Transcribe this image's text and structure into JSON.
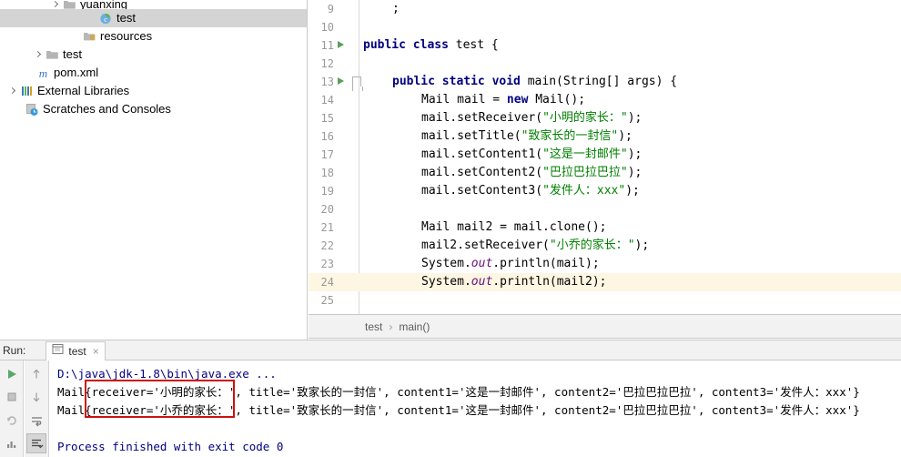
{
  "project_tree": {
    "items": [
      {
        "label": "yuanxing",
        "icon": "package-icon",
        "indent": 55,
        "arrow": true,
        "selected": false,
        "clipped": true
      },
      {
        "label": "test",
        "icon": "java-class-icon",
        "indent": 95,
        "arrow": false,
        "selected": true,
        "clipped": false
      },
      {
        "label": "resources",
        "icon": "resources-folder-icon",
        "indent": 77,
        "arrow": false,
        "selected": false,
        "clipped": false
      },
      {
        "label": "test",
        "icon": "folder-icon",
        "indent": 36,
        "arrow": true,
        "selected": false,
        "clipped": false
      },
      {
        "label": "pom.xml",
        "icon": "maven-icon",
        "indent": 26,
        "arrow": false,
        "selected": false,
        "clipped": false
      },
      {
        "label": "External Libraries",
        "icon": "libraries-icon",
        "indent": 8,
        "arrow": true,
        "selected": false,
        "clipped": false
      },
      {
        "label": "Scratches and Consoles",
        "icon": "scratches-icon",
        "indent": 14,
        "arrow": false,
        "selected": false,
        "clipped": false
      }
    ]
  },
  "editor": {
    "lines": [
      {
        "num": "9",
        "indent": 1,
        "run": false,
        "fold": false,
        "current": false,
        "tokens": [
          {
            "t": ";",
            "c": "pln"
          }
        ]
      },
      {
        "num": "10",
        "indent": 0,
        "run": false,
        "fold": false,
        "current": false,
        "tokens": []
      },
      {
        "num": "11",
        "indent": 0,
        "run": true,
        "fold": false,
        "current": false,
        "tokens": [
          {
            "t": "public class ",
            "c": "kw"
          },
          {
            "t": "test {",
            "c": "pln"
          }
        ]
      },
      {
        "num": "12",
        "indent": 0,
        "run": false,
        "fold": false,
        "current": false,
        "tokens": []
      },
      {
        "num": "13",
        "indent": 1,
        "run": true,
        "fold": true,
        "current": false,
        "tokens": [
          {
            "t": "public static void ",
            "c": "kw"
          },
          {
            "t": "main(String[] args) {",
            "c": "pln"
          }
        ]
      },
      {
        "num": "14",
        "indent": 2,
        "run": false,
        "fold": false,
        "current": false,
        "tokens": [
          {
            "t": "Mail mail = ",
            "c": "pln"
          },
          {
            "t": "new ",
            "c": "kw"
          },
          {
            "t": "Mail();",
            "c": "pln"
          }
        ]
      },
      {
        "num": "15",
        "indent": 2,
        "run": false,
        "fold": false,
        "current": false,
        "tokens": [
          {
            "t": "mail.setReceiver(",
            "c": "pln"
          },
          {
            "t": "\"小明的家长：\"",
            "c": "str"
          },
          {
            "t": ");",
            "c": "pln"
          }
        ]
      },
      {
        "num": "16",
        "indent": 2,
        "run": false,
        "fold": false,
        "current": false,
        "tokens": [
          {
            "t": "mail.setTitle(",
            "c": "pln"
          },
          {
            "t": "\"致家长的一封信\"",
            "c": "str"
          },
          {
            "t": ");",
            "c": "pln"
          }
        ]
      },
      {
        "num": "17",
        "indent": 2,
        "run": false,
        "fold": false,
        "current": false,
        "tokens": [
          {
            "t": "mail.setContent1(",
            "c": "pln"
          },
          {
            "t": "\"这是一封邮件\"",
            "c": "str"
          },
          {
            "t": ");",
            "c": "pln"
          }
        ]
      },
      {
        "num": "18",
        "indent": 2,
        "run": false,
        "fold": false,
        "current": false,
        "tokens": [
          {
            "t": "mail.setContent2(",
            "c": "pln"
          },
          {
            "t": "\"巴拉巴拉巴拉\"",
            "c": "str"
          },
          {
            "t": ");",
            "c": "pln"
          }
        ]
      },
      {
        "num": "19",
        "indent": 2,
        "run": false,
        "fold": false,
        "current": false,
        "tokens": [
          {
            "t": "mail.setContent3(",
            "c": "pln"
          },
          {
            "t": "\"发件人：xxx\"",
            "c": "str"
          },
          {
            "t": ");",
            "c": "pln"
          }
        ]
      },
      {
        "num": "20",
        "indent": 0,
        "run": false,
        "fold": false,
        "current": false,
        "tokens": []
      },
      {
        "num": "21",
        "indent": 2,
        "run": false,
        "fold": false,
        "current": false,
        "tokens": [
          {
            "t": "Mail mail2 = mail.clone();",
            "c": "pln"
          }
        ]
      },
      {
        "num": "22",
        "indent": 2,
        "run": false,
        "fold": false,
        "current": false,
        "tokens": [
          {
            "t": "mail2.setReceiver(",
            "c": "pln"
          },
          {
            "t": "\"小乔的家长：\"",
            "c": "str"
          },
          {
            "t": ");",
            "c": "pln"
          }
        ]
      },
      {
        "num": "23",
        "indent": 2,
        "run": false,
        "fold": false,
        "current": false,
        "tokens": [
          {
            "t": "System.",
            "c": "pln"
          },
          {
            "t": "out",
            "c": "fld"
          },
          {
            "t": ".println(mail);",
            "c": "pln"
          }
        ]
      },
      {
        "num": "24",
        "indent": 2,
        "run": false,
        "fold": false,
        "current": true,
        "tokens": [
          {
            "t": "System.",
            "c": "pln"
          },
          {
            "t": "out",
            "c": "fld"
          },
          {
            "t": ".println(mail2);",
            "c": "pln"
          }
        ]
      },
      {
        "num": "25",
        "indent": 0,
        "run": false,
        "fold": false,
        "current": false,
        "tokens": []
      }
    ]
  },
  "breadcrumb": {
    "class_name": "test",
    "separator": "›",
    "method_name": "main()"
  },
  "run_panel": {
    "run_label": "Run:",
    "tab_name": "test",
    "tab_close": "×",
    "toolbar_left": [
      "run-icon",
      "stop-icon",
      "rerun-failed-icon",
      "coverage-icon"
    ],
    "toolbar_right": [
      "scroll-up-icon",
      "scroll-down-icon",
      "soft-wrap-icon",
      "scroll-to-end-icon"
    ],
    "console": {
      "command": "D:\\java\\jdk-1.8\\bin\\java.exe ...",
      "output_lines": [
        "Mail{receiver='小明的家长：', title='致家长的一封信', content1='这是一封邮件', content2='巴拉巴拉巴拉', content3='发件人：xxx'}",
        "Mail{receiver='小乔的家长：', title='致家长的一封信', content1='这是一封邮件', content2='巴拉巴拉巴拉', content3='发件人：xxx'}"
      ],
      "exit_message": "Process finished with exit code 0"
    }
  },
  "annotation": {
    "box_color": "#cc1111",
    "highlights": [
      "receiver='小明的家长：'",
      "receiver='小乔的家长：'"
    ]
  },
  "colors": {
    "selection": "#d4d4d4",
    "current_line": "#fdf6e3",
    "keyword": "#000080",
    "string": "#008000",
    "field": "#660e7a",
    "gutter_text": "#999999",
    "panel_bg": "#f2f2f2",
    "annotation_red": "#cc1111"
  }
}
